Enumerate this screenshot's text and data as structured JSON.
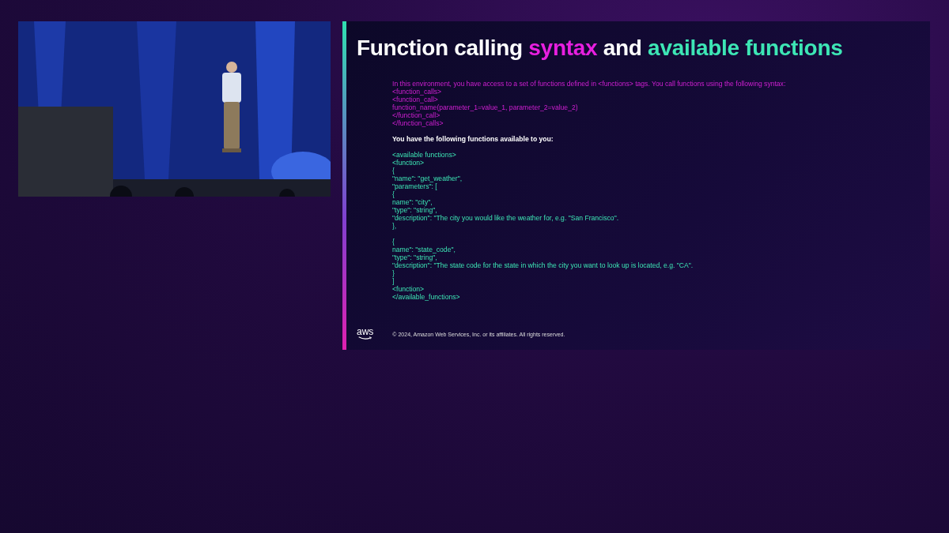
{
  "slide": {
    "title": [
      {
        "text": "Function calling ",
        "kind": "plain"
      },
      {
        "text": "syntax",
        "kind": "magenta"
      },
      {
        "text": " and ",
        "kind": "plain"
      },
      {
        "text": "available functions",
        "kind": "green"
      }
    ],
    "blocks": [
      {
        "kind": "syntax",
        "lines": [
          "In this environment, you have access to a set of functions defined in <functions> tags. You call functions using the following syntax:",
          "<function_calls>",
          "<function_call>",
          "function_name(parameter_1=value_1, parameter_2=value_2)",
          "</function_call>",
          "</function_calls>"
        ]
      },
      {
        "kind": "heading",
        "lines": [
          "You have the following functions available to you:"
        ]
      },
      {
        "kind": "code",
        "lines": [
          "<available functions>",
          "<function>",
          "{",
          "\"name\": \"get_weather\",",
          "\"parameters\": [",
          "{",
          "name\": \"city\",",
          "\"type\": \"string\",",
          "\"description\": \"The city you would like the weather for, e.g. \"San Francisco\".",
          "},"
        ]
      },
      {
        "kind": "code",
        "lines": [
          "{",
          "name\": \"state_code\",",
          "\"type\": \"string\",",
          "\"description\": \"The state code for the state in which the city you want to look up is located, e.g. \"CA\".",
          "}",
          "]",
          "<function>",
          "</available_functions>"
        ]
      }
    ],
    "footer": {
      "logo": "aws",
      "copyright": "© 2024, Amazon Web Services, Inc. or its affiliates. All rights reserved."
    }
  }
}
